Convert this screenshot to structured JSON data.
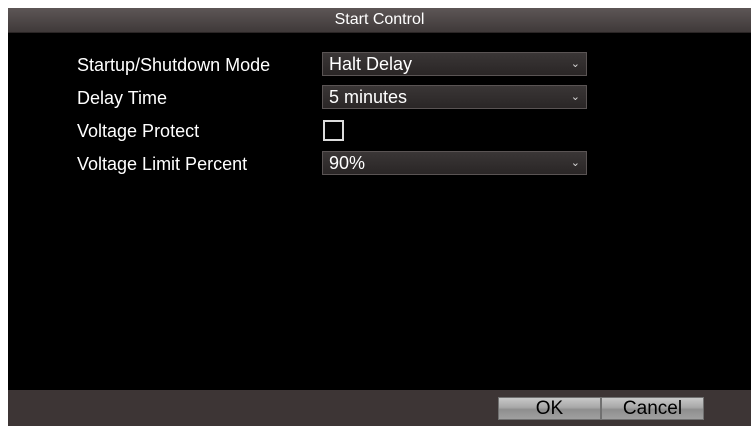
{
  "window": {
    "title": "Start Control"
  },
  "form": {
    "startup_mode": {
      "label": "Startup/Shutdown Mode",
      "value": "Halt Delay"
    },
    "delay_time": {
      "label": "Delay Time",
      "value": "5 minutes"
    },
    "voltage_protect": {
      "label": "Voltage Protect",
      "checked": false
    },
    "voltage_limit": {
      "label": "Voltage Limit Percent",
      "value": "90%"
    }
  },
  "footer": {
    "ok_label": "OK",
    "cancel_label": "Cancel"
  },
  "icons": {
    "dropdown": "chevron-down-icon"
  }
}
